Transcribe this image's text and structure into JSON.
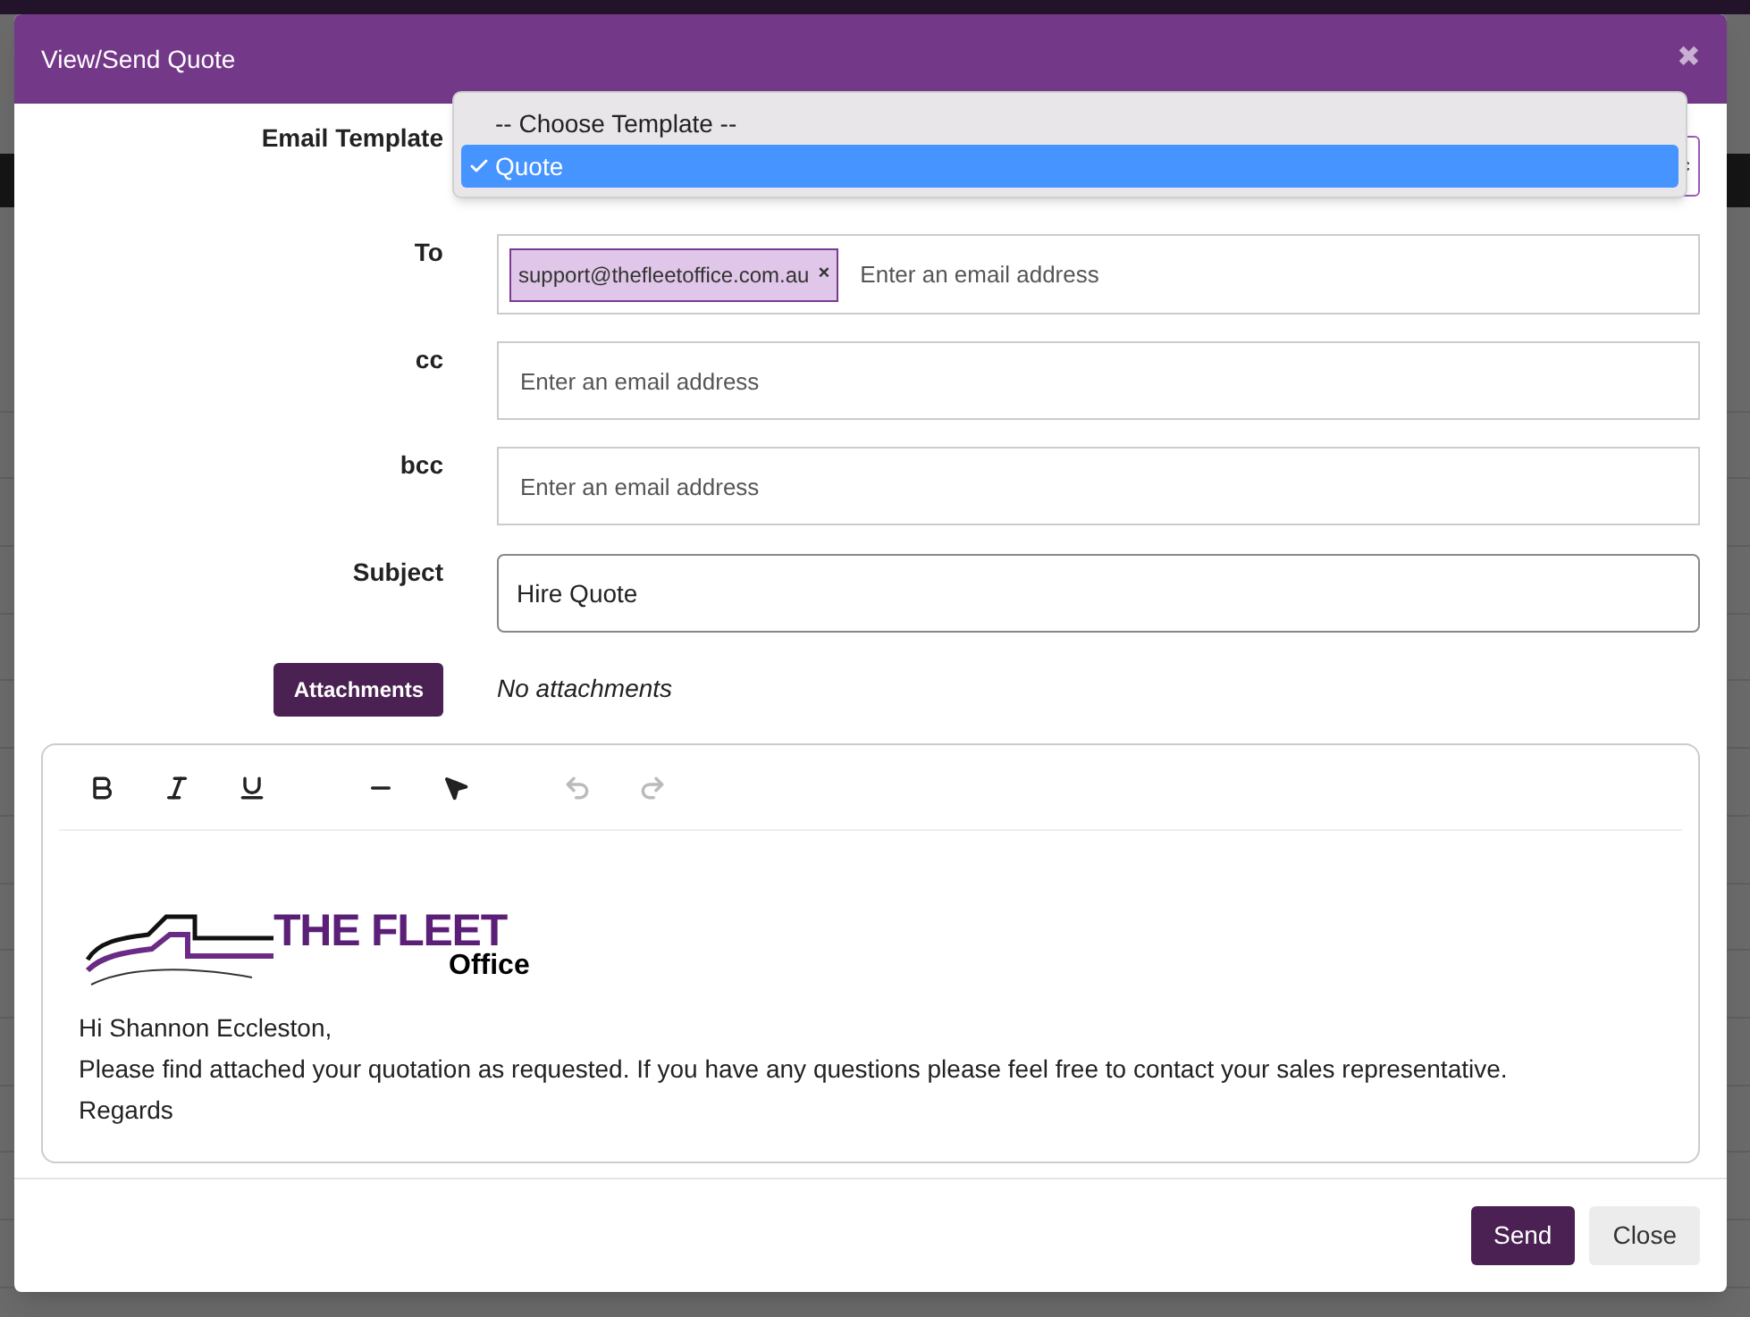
{
  "dialog": {
    "title": "View/Send Quote",
    "close_icon": "✖",
    "template": {
      "label": "Email Template",
      "options": [
        {
          "label": "-- Choose Template --",
          "selected": false
        },
        {
          "label": "Quote",
          "selected": true
        }
      ]
    },
    "to": {
      "label": "To",
      "chips": [
        "support@thefleetoffice.com.au"
      ],
      "chip_remove": "×",
      "placeholder": "Enter an email address"
    },
    "cc": {
      "label": "cc",
      "placeholder": "Enter an email address"
    },
    "bcc": {
      "label": "bcc",
      "placeholder": "Enter an email address"
    },
    "subject": {
      "label": "Subject",
      "value": "Hire Quote"
    },
    "attachments": {
      "button": "Attachments",
      "status": "No attachments"
    },
    "editor": {
      "toolbar": [
        {
          "kind": "bold",
          "disabled": false
        },
        {
          "kind": "italic",
          "disabled": false
        },
        {
          "kind": "underline",
          "disabled": false
        },
        {
          "kind": "rule",
          "disabled": false
        },
        {
          "kind": "pointer",
          "disabled": false
        },
        {
          "kind": "undo",
          "disabled": true
        },
        {
          "kind": "redo",
          "disabled": true
        }
      ],
      "logo": {
        "title": "THE FLEET",
        "subtitle": "Office"
      },
      "lines": [
        "Hi Shannon Eccleston,",
        "Please find attached your quotation as requested. If you have any questions please feel free to contact your sales representative.",
        "Regards"
      ]
    },
    "buttons": [
      {
        "label": "Send",
        "kind": "primary"
      },
      {
        "label": "Close",
        "kind": "secondary"
      }
    ]
  }
}
